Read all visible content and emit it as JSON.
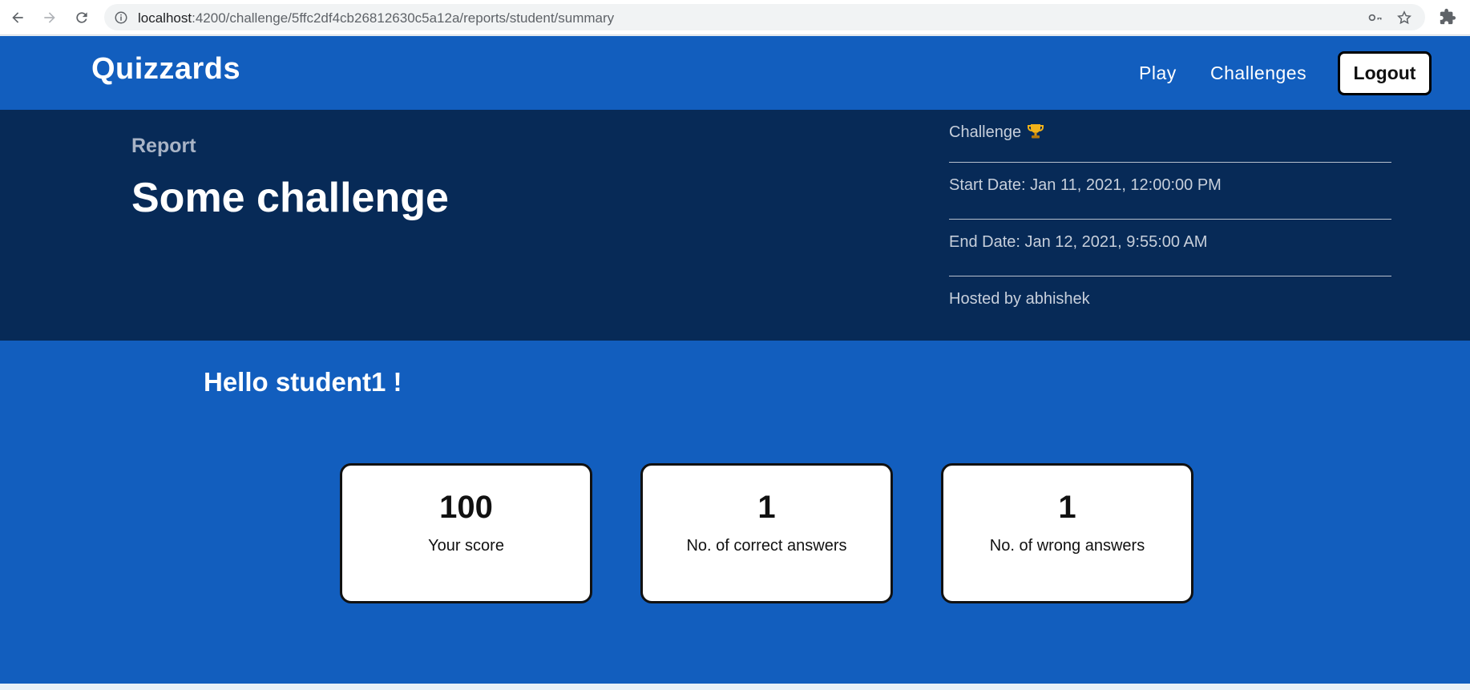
{
  "browser": {
    "url_host": "localhost",
    "url_path": ":4200/challenge/5ffc2df4cb26812630c5a12a/reports/student/summary",
    "icons": [
      "back-arrow-icon",
      "forward-arrow-icon",
      "reload-icon",
      "info-icon",
      "key-icon",
      "star-icon",
      "puzzle-icon"
    ]
  },
  "header": {
    "brand": "Quizzards",
    "nav": [
      {
        "label": "Play"
      },
      {
        "label": "Challenges"
      }
    ],
    "logout_label": "Logout",
    "bg_color": "#125ebe"
  },
  "report": {
    "label": "Report",
    "title": "Some challenge",
    "type_label": "Challenge",
    "start_date": "Start Date: Jan 11, 2021, 12:00:00 PM",
    "end_date": "End Date: Jan 12, 2021, 9:55:00 AM",
    "hosted_by": "Hosted by abhishek",
    "bg_color": "#072a57"
  },
  "summary": {
    "greeting": "Hello student1 !",
    "cards": [
      {
        "value": "100",
        "label": "Your score"
      },
      {
        "value": "1",
        "label": "No. of correct answers"
      },
      {
        "value": "1",
        "label": "No. of wrong answers"
      }
    ]
  }
}
